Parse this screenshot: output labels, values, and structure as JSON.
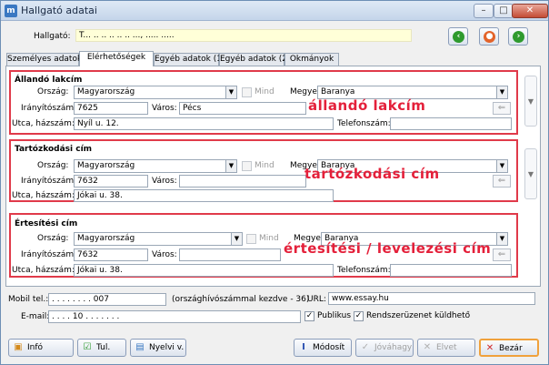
{
  "window": {
    "title": "Hallgató adatai",
    "app_icon": "m"
  },
  "header": {
    "label": "Hallgató:",
    "value": "T... .. .. .. .. .. ..., ..... ....."
  },
  "tabs": [
    {
      "label": "Személyes adatok"
    },
    {
      "label": "Elérhetőségek"
    },
    {
      "label": "Egyéb adatok (1)"
    },
    {
      "label": "Egyéb adatok (2)"
    },
    {
      "label": "Okmányok"
    }
  ],
  "labels": {
    "orszag": "Ország:",
    "mind": "Mind",
    "megye": "Megye:",
    "iranyitoszam": "Irányítószám:",
    "varos": "Város:",
    "utca": "Utca, házszám:",
    "telefon": "Telefonszám:"
  },
  "sections": {
    "allando": {
      "title": "Állandó lakcím",
      "orszag": "Magyarország",
      "megye": "Baranya",
      "irsz": "7625",
      "varos": "Pécs",
      "utca": "Nyíl u. 12.",
      "telefon": "",
      "annotation": "állandó lakcím"
    },
    "tartozkodasi": {
      "title": "Tartózkodási cím",
      "orszag": "Magyarország",
      "megye": "Baranya",
      "irsz": "7632",
      "varos": "",
      "utca": "Jókai u. 38.",
      "telefon": "",
      "annotation": "tartózkodási cím"
    },
    "ertesitesi": {
      "title": "Értesítési cím",
      "orszag": "Magyarország",
      "megye": "Baranya",
      "irsz": "7632",
      "varos": "",
      "utca": "Jókai u. 38.",
      "telefon": "",
      "annotation": "értesítési / levelezési cím"
    }
  },
  "contact": {
    "mobil_label": "Mobil tel.:",
    "mobil_value": ". . . . . . . . 007",
    "mobil_hint": "(országhívószámmal kezdve - 36)",
    "url_label": "URL:",
    "url_value": "www.essay.hu",
    "email_label": "E-mail:",
    "email_value": ". . . . 10 . . . . . . .",
    "publikus": "Publikus",
    "rendszeruzenet": "Rendszerüzenet küldhető"
  },
  "buttons": {
    "info": "Infó",
    "tul": "Tul.",
    "nyelvi": "Nyelvi v.",
    "modosit": "Módosít",
    "jovahagy": "Jóváhagy",
    "elvet": "Elvet",
    "bezar": "Bezár"
  },
  "colors": {
    "accent_red": "#e4203a",
    "nav_green": "#2e9a2e",
    "nav_orange": "#e3632a"
  }
}
